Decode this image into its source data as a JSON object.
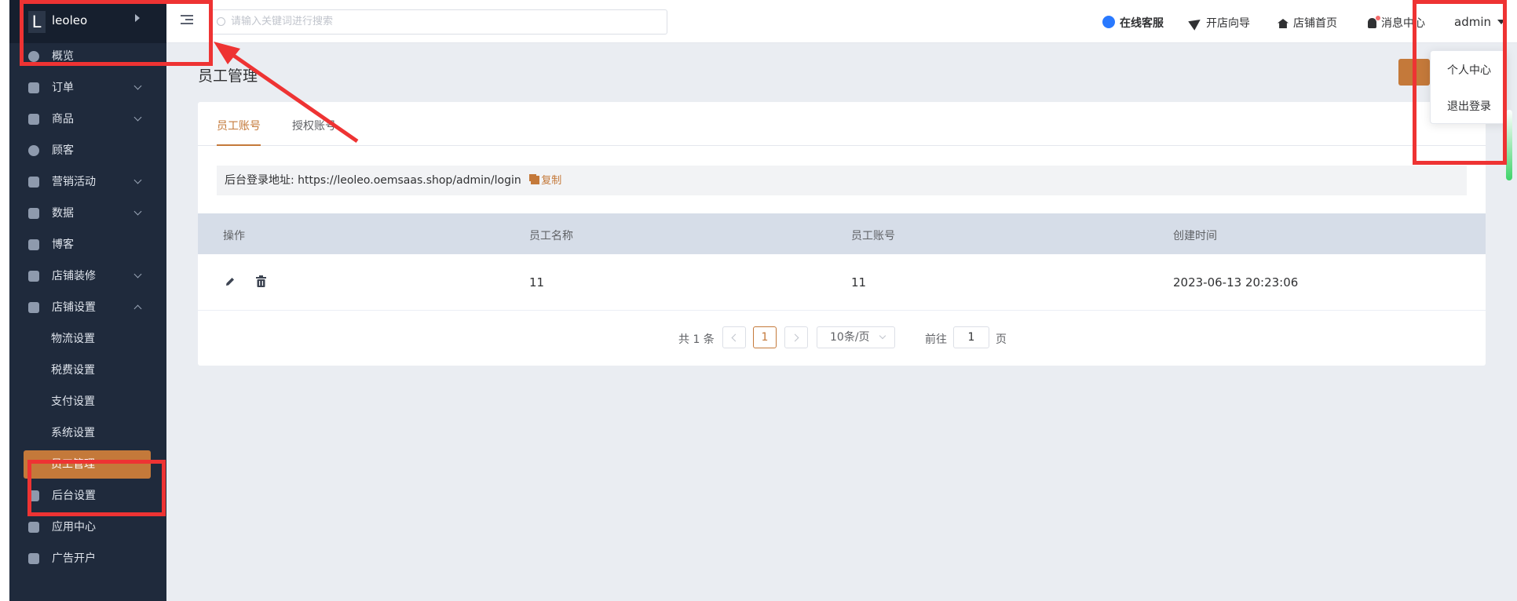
{
  "brand": {
    "logo_letter": "L",
    "name": "leoleo"
  },
  "sidebar": {
    "items": [
      {
        "label": "概览",
        "icon": "dashboard-icon",
        "chevron": "none"
      },
      {
        "label": "订单",
        "icon": "order-icon",
        "chevron": "down"
      },
      {
        "label": "商品",
        "icon": "box-icon",
        "chevron": "down"
      },
      {
        "label": "顾客",
        "icon": "user-icon",
        "chevron": "none"
      },
      {
        "label": "营销活动",
        "icon": "tag-icon",
        "chevron": "down"
      },
      {
        "label": "数据",
        "icon": "bar-chart-icon",
        "chevron": "down"
      },
      {
        "label": "博客",
        "icon": "blog-icon",
        "chevron": "none"
      },
      {
        "label": "店铺装修",
        "icon": "paint-roller-icon",
        "chevron": "down"
      },
      {
        "label": "店铺设置",
        "icon": "store-settings-icon",
        "chevron": "up"
      }
    ],
    "sub_items": [
      "物流设置",
      "税费设置",
      "支付设置",
      "系统设置",
      "员工管理"
    ],
    "active_sub": "员工管理",
    "after_items": [
      {
        "label": "后台设置",
        "icon": "settings-icon"
      },
      {
        "label": "应用中心",
        "icon": "wrench-icon"
      },
      {
        "label": "广告开户",
        "icon": "ads-icon"
      }
    ]
  },
  "header": {
    "search_placeholder": "请输入关键词进行搜索",
    "online_service": "在线客服",
    "shop_guide": "开店向导",
    "shop_home": "店铺首页",
    "message_center": "消息中心",
    "user": "admin"
  },
  "user_menu": {
    "profile": "个人中心",
    "logout": "退出登录"
  },
  "page": {
    "title": "员工管理"
  },
  "tabs": {
    "staff_account": "员工账号",
    "authorized_account": "授权账号",
    "active": "员工账号"
  },
  "login_bar": {
    "label": "后台登录地址: https://leoleo.oemsaas.shop/admin/login",
    "copy": "复制"
  },
  "table": {
    "headers": [
      "操作",
      "员工名称",
      "员工账号",
      "创建时间"
    ],
    "rows": [
      {
        "name": "11",
        "account": "11",
        "created": "2023-06-13 20:23:06"
      }
    ]
  },
  "pagination": {
    "total": "共 1 条",
    "current_page": "1",
    "page_size": "10条/页",
    "goto_label": "前往",
    "goto_value": "1",
    "page_suffix": "页"
  },
  "colors": {
    "sidebar_bg": "#1f2a3c",
    "accent": "#c4793a",
    "annotation_red": "#ee3333",
    "online_dot": "#2979ff"
  }
}
